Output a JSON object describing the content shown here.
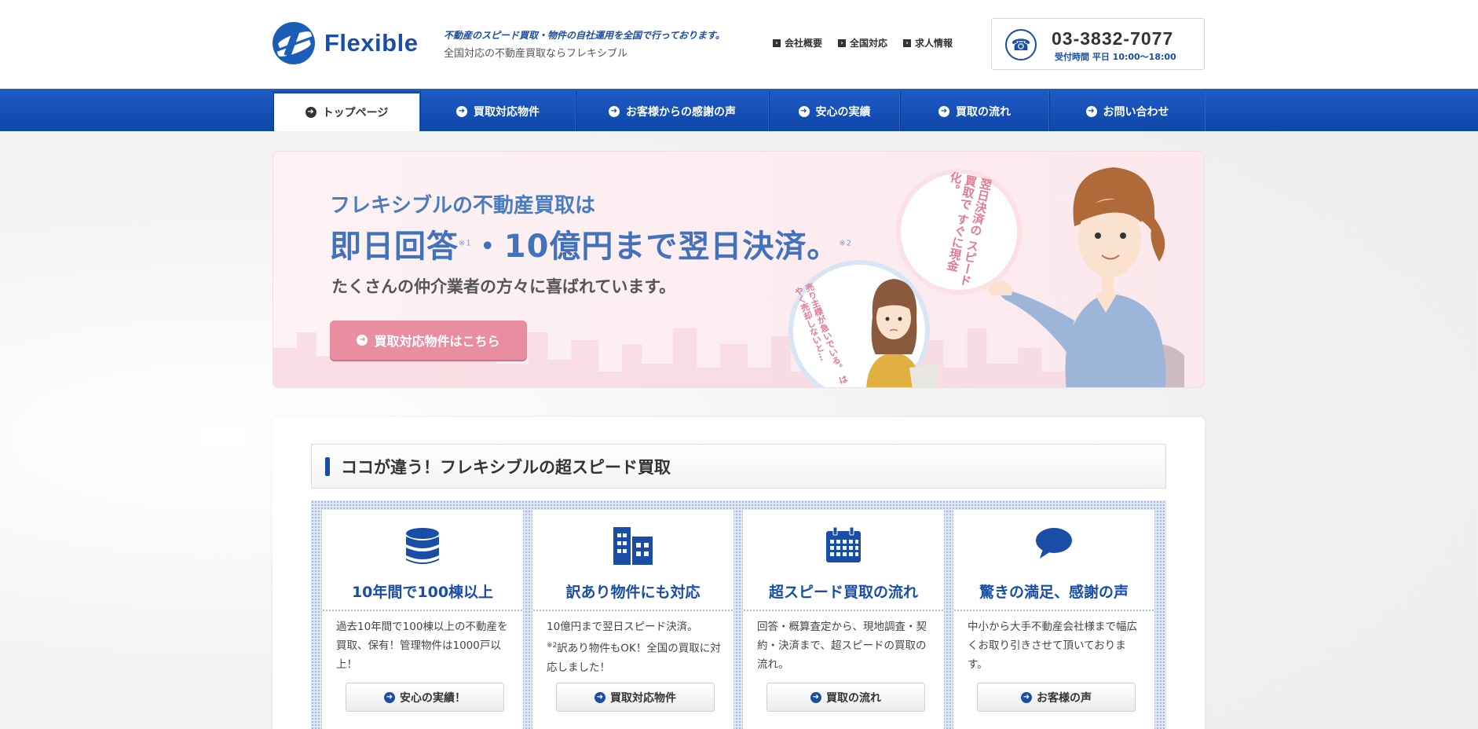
{
  "header": {
    "brand": "Flexible",
    "tagline_top": "不動産のスピード買取・物件の自社運用を全国で行っております。",
    "tagline_bottom": "全国対応の不動産買取ならフレキシブル",
    "links": [
      {
        "label": "会社概要"
      },
      {
        "label": "全国対応"
      },
      {
        "label": "求人情報"
      }
    ],
    "tel": {
      "number": "03-3832-7077",
      "hours": "受付時間 平日 10:00～18:00"
    }
  },
  "nav": {
    "items": [
      {
        "label": "トップページ",
        "active": true
      },
      {
        "label": "買取対応物件"
      },
      {
        "label": "お客様からの感謝の声"
      },
      {
        "label": "安心の実績"
      },
      {
        "label": "買取の流れ"
      },
      {
        "label": "お問い合わせ"
      }
    ]
  },
  "hero": {
    "line1": "フレキシブルの不動産買取は",
    "line2_part1": "即日回答",
    "line2_note1": "※1",
    "line2_part2": "・10億円まで翌日決済。",
    "line2_note2": "※2",
    "line3": "たくさんの仲介業者の方々に喜ばれています。",
    "button": "買取対応物件はこちら",
    "bubble_big": "翌日決済の\nスピード買取で\nすぐに現金化。",
    "bubble_small": "売り主様が急いでいる。\nはやく売却しないと…"
  },
  "features": {
    "heading": "ココが違う！フレキシブルの超スピード買取",
    "cards": [
      {
        "icon": "database-icon",
        "title": "10年間で100棟以上",
        "body": "過去10年間で100棟以上の不動産を買取、保有！管理物件は1000戸以上！",
        "button": "安心の実績！"
      },
      {
        "icon": "building-icon",
        "title": "訳あり物件にも対応",
        "body_pre": "10億円まで翌日スピード決済。",
        "body_note": "※2",
        "body_post": "訳あり物件もOK！全国の買取に対応しました！",
        "button": "買取対応物件"
      },
      {
        "icon": "calendar-icon",
        "title": "超スピード買取の流れ",
        "body": "回答・概算査定から、現地調査・契約・決済まで、超スピードの買取の流れ。",
        "button": "買取の流れ"
      },
      {
        "icon": "speech-bubble-icon",
        "title": "驚きの満足、感謝の声",
        "body": "中小から大手不動産会社様まで幅広くお取り引きさせて頂いております。",
        "button": "お客様の声"
      }
    ]
  },
  "colors": {
    "brand_blue": "#1a4da6",
    "nav_blue": "#1e5cc6",
    "hero_pink": "#e98ea1"
  }
}
